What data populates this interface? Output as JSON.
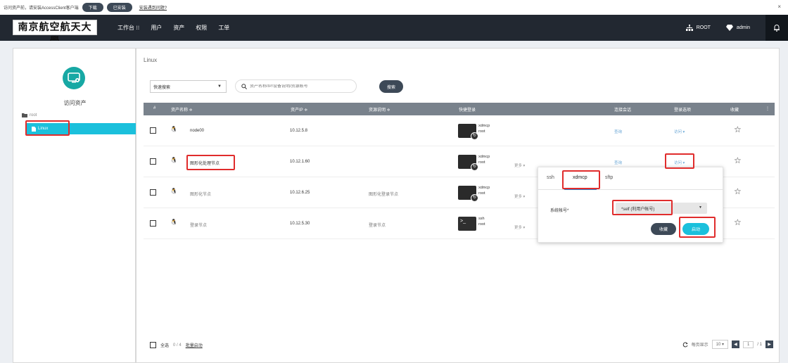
{
  "banner": {
    "text": "访问资产前，请安装AccessClient客户端",
    "download": "下载",
    "installed": "已安装",
    "link": "安装遇到问题?",
    "close": "×"
  },
  "nav": {
    "logo": "南京航空航天大學",
    "menu": [
      "工作台 ⁝⁝",
      "用户",
      "资产",
      "权限",
      "工单"
    ],
    "root_label": "ROOT",
    "user_label": "admin"
  },
  "left": {
    "title": "访问资产",
    "tree_root": "root",
    "tree_selected": "Linux"
  },
  "main": {
    "breadcrumb": "Linux",
    "filter_select": "快速搜索",
    "search_placeholder": "资产名称/IP/设备说明/资源账号",
    "search_button": "搜索",
    "columns": [
      "#",
      "资产名称 ≑",
      "资产IP ≑",
      "资源说明 ≑",
      "快捷登录",
      "连接会话",
      "登录选项",
      "收藏",
      "⋮"
    ],
    "rows": [
      {
        "name": "node00",
        "ip": "10.12.5.8",
        "desc": "",
        "protocol": "xdmcp",
        "account": "root",
        "more": "",
        "session": "查询",
        "login": "访问 ▾"
      },
      {
        "name": "图形化处理节点",
        "ip": "10.12.1.60",
        "desc": "",
        "protocol": "xdmcp",
        "account": "root",
        "more": "更多 ▾",
        "session": "查询",
        "login": "访问 ▾"
      },
      {
        "name": "图形化节点",
        "ip": "10.12.6.25",
        "desc": "图形化登录节点",
        "protocol": "xdmcp",
        "account": "root",
        "more": "更多 ▾",
        "session": "",
        "login": ""
      },
      {
        "name": "登录节点",
        "ip": "10.12.5.30",
        "desc": "登录节点",
        "protocol": "ssh",
        "account": "root",
        "more": "更多 ▾",
        "session": "",
        "login": ""
      }
    ]
  },
  "popover": {
    "tabs": [
      "ssh",
      "xdmcp",
      "sftp"
    ],
    "field_label": "系统帐号*",
    "field_value": "*self (利用户帐号)",
    "save": "收藏",
    "start": "启动"
  },
  "footer": {
    "select_all": "全选",
    "count": "0 / 4",
    "batch": "批量启动",
    "page_size_label": "每页显示",
    "page_size": "10 ▾",
    "page_num": "1",
    "page_total": "/ 1"
  },
  "colors": {
    "nav_bg": "#222831",
    "accent": "#1bc0dc",
    "dark_button": "#3d4957",
    "highlight": "#e02c2c"
  }
}
